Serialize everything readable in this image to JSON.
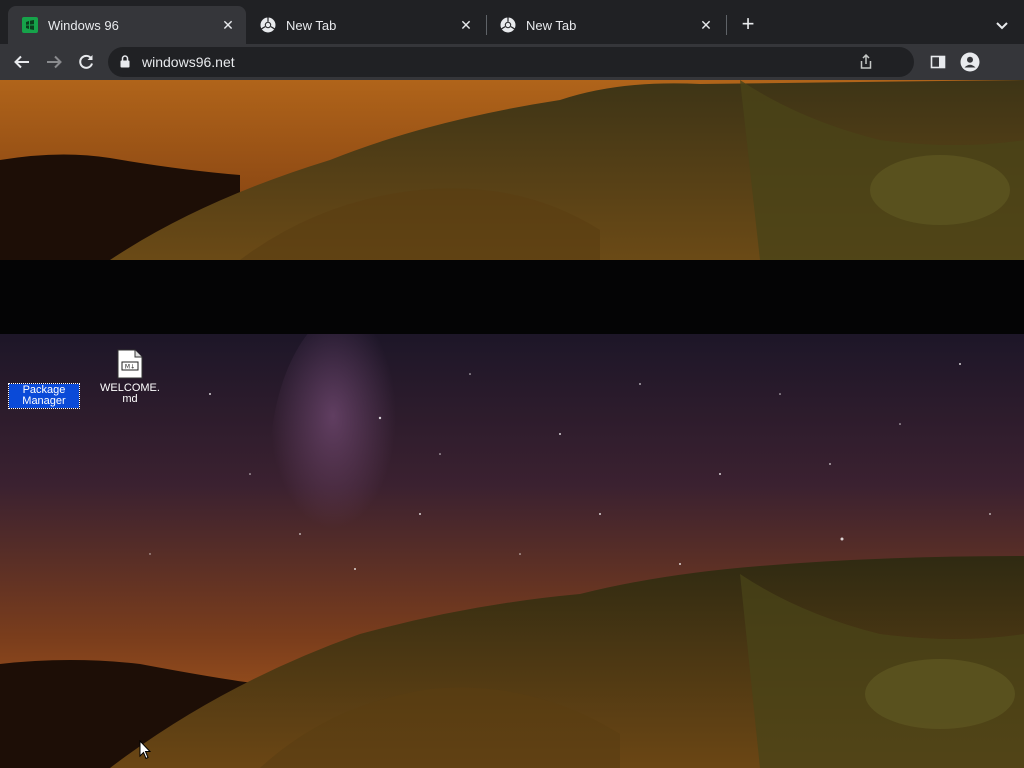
{
  "browser": {
    "tabs": [
      {
        "title": "Windows 96",
        "active": true,
        "favicon": "windows96-logo-icon"
      },
      {
        "title": "New Tab",
        "active": false,
        "favicon": "chrome-icon"
      },
      {
        "title": "New Tab",
        "active": false,
        "favicon": "chrome-icon"
      }
    ],
    "new_tab_label": "+",
    "url": "windows96.net"
  },
  "desktop": {
    "icons": [
      {
        "label": "Package Manager",
        "selected": true
      },
      {
        "label": "WELCOME.md",
        "icon_text": "M↓",
        "selected": false
      }
    ]
  },
  "colors": {
    "tab_strip": "#202124",
    "toolbar": "#35363a",
    "selection": "#0a4ad8",
    "windows96_green": "#16a34a"
  }
}
